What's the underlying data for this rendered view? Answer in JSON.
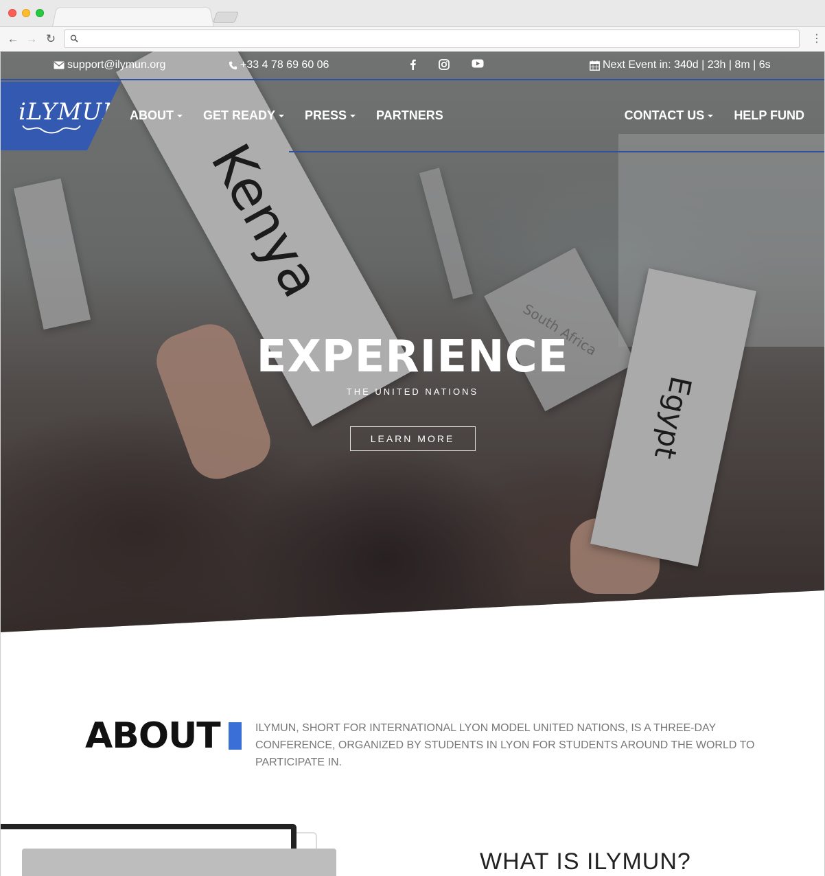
{
  "topbar": {
    "email": "support@ilymun.org",
    "phone": "+33 4 78 69 60 06",
    "event": "Next Event in: 340d | 23h | 8m | 6s",
    "social_icons": [
      "facebook-icon",
      "instagram-icon",
      "youtube-icon"
    ],
    "icons": {
      "email": "envelope-icon",
      "phone": "phone-icon",
      "event": "calendar-icon"
    }
  },
  "brand": {
    "logo_text": "iLYMUN",
    "color": "#3459b0"
  },
  "nav": {
    "left": [
      {
        "label": "ABOUT",
        "dropdown": true
      },
      {
        "label": "GET READY",
        "dropdown": true
      },
      {
        "label": "PRESS",
        "dropdown": true
      },
      {
        "label": "PARTNERS",
        "dropdown": false
      }
    ],
    "right": [
      {
        "label": "CONTACT US",
        "dropdown": true
      },
      {
        "label": "HELP FUND",
        "dropdown": false
      }
    ]
  },
  "hero": {
    "title": "EXPERIENCE",
    "subtitle": "THE UNITED NATIONS",
    "button": "LEARN MORE",
    "signs": [
      "Kenya",
      "Egypt",
      "South Africa"
    ]
  },
  "about": {
    "title": "ABOUT",
    "text": "ILYMUN, SHORT FOR INTERNATIONAL LYON MODEL UNITED NATIONS, IS A THREE-DAY CONFERENCE, ORGANIZED BY STUDENTS IN LYON FOR STUDENTS AROUND THE WORLD TO PARTICIPATE IN.",
    "accent_color": "#3b6fd8"
  },
  "what": {
    "title": "WHAT IS ILYMUN?"
  }
}
